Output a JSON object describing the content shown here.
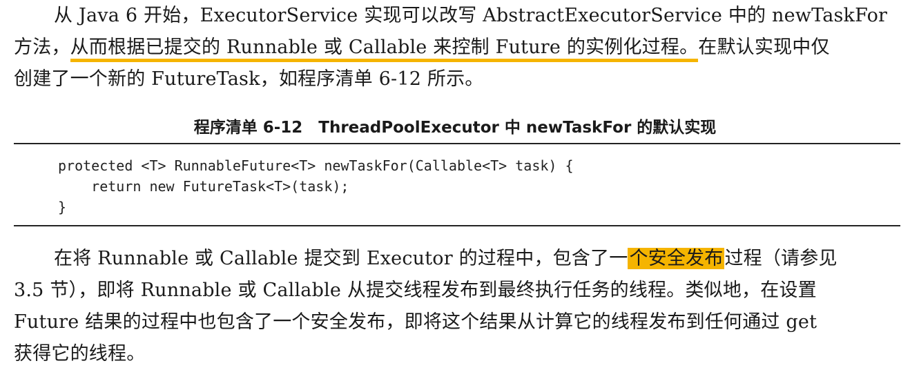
{
  "paragraph1": {
    "line1": "从 Java 6 开始，ExecutorService 实现可以改写 AbstractExecutorService 中的 newTaskFor",
    "line2_before": "方法，",
    "line2_underlined": "从而根据已提交的 Runnable 或 Callable 来控制 Future 的实例化过程。",
    "line2_after": "在默认实现中仅",
    "line3": "创建了一个新的 FutureTask，如程序清单 6-12 所示。"
  },
  "listing": {
    "title": "程序清单 6-12　ThreadPoolExecutor 中 newTaskFor 的默认实现",
    "code": [
      "protected <T> RunnableFuture<T> newTaskFor(Callable<T> task) {",
      "    return new FutureTask<T>(task);",
      "}"
    ]
  },
  "paragraph2": {
    "line1_before": "在将 Runnable 或 Callable 提交到 Executor 的过程中，包含了一",
    "line1_highlight": "个安全发布",
    "line1_after": "过程（请参见",
    "line2": "3.5 节），即将 Runnable 或 Callable 从提交线程发布到最终执行任务的线程。类似地，在设置",
    "line3": "Future 结果的过程中也包含了一个安全发布，即将这个结果从计算它的线程发布到任何通过 get",
    "line4": "获得它的线程。"
  },
  "colors": {
    "annotation": "#f5b400"
  }
}
